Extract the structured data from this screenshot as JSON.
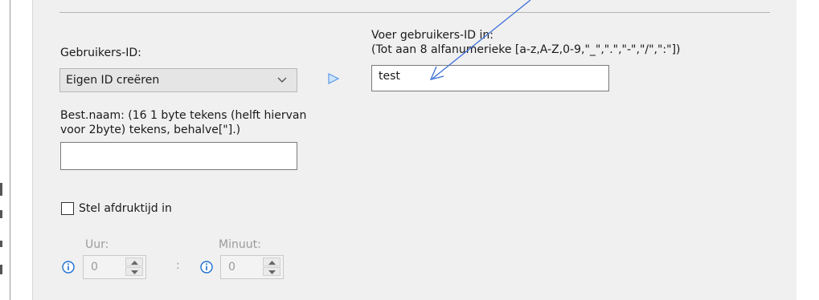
{
  "user_id": {
    "label": "Gebruikers-ID:",
    "selected": "Eigen ID creëren",
    "chevron_icon": "chevron-down-icon",
    "arrow_icon": "play-arrow-icon"
  },
  "enter_id": {
    "label_line1": "Voer gebruikers-ID in:",
    "label_line2": "(Tot aan 8 alfanumerieke [a-z,A-Z,0-9,\"_\",\".\",\"-\",\"/\",\":\"])",
    "value": "test"
  },
  "file_name": {
    "label_line1": "Best.naam: (16 1 byte tekens (helft hiervan",
    "label_line2": "voor 2byte) tekens, behalve[\"].)",
    "value": ""
  },
  "print_time": {
    "checkbox_label": "Stel afdruktijd in",
    "checked": false,
    "hour_label": "Uur:",
    "hour_value": "0",
    "minute_label": "Minuut:",
    "minute_value": "0",
    "separator": ":",
    "info_icon": "info-icon",
    "info_color": "#1c6fd1"
  },
  "annotation": {
    "type": "arrow",
    "color": "#3a6fd8"
  }
}
